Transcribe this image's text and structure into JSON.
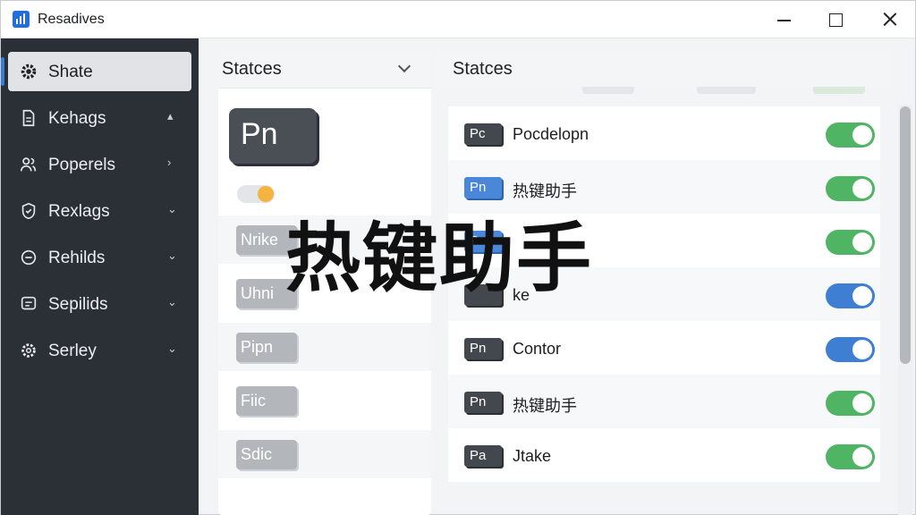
{
  "window": {
    "title": "Resadives"
  },
  "sidebar": {
    "items": [
      {
        "label": "Shate",
        "icon": "gear-icon",
        "active": true
      },
      {
        "label": "Kehags",
        "icon": "document-icon",
        "chevron": "up"
      },
      {
        "label": "Poperels",
        "icon": "users-icon",
        "chevron": "right"
      },
      {
        "label": "Rexlags",
        "icon": "shield-icon",
        "chevron": "down"
      },
      {
        "label": "Rehilds",
        "icon": "circle-minus-icon",
        "chevron": "down"
      },
      {
        "label": "Sepilids",
        "icon": "chat-icon",
        "chevron": "down"
      },
      {
        "label": "Serley",
        "icon": "gear-icon",
        "chevron": "down"
      }
    ]
  },
  "left_panel": {
    "title": "Statces",
    "large_badge": "Pn",
    "chips": [
      "Nrike",
      "Uhni",
      "Pipn",
      "Fiic",
      "Sdic"
    ]
  },
  "right_panel": {
    "title": "Statces",
    "rows": [
      {
        "badge": "Pc",
        "label": "Pocdelopn",
        "toggle": "on",
        "toggle_color": "#4fb463"
      },
      {
        "badge": "Pn",
        "label": "热键助手",
        "toggle": "on",
        "toggle_color": "#4fb463",
        "badge_color": "#4a87d8"
      },
      {
        "badge": "P",
        "label": "",
        "toggle": "on",
        "toggle_color": "#4fb463",
        "badge_color": "#4a87d8"
      },
      {
        "badge": "",
        "label": "ke",
        "toggle": "on",
        "toggle_color": "#3e7fd4"
      },
      {
        "badge": "Pn",
        "label": "Contor",
        "toggle": "on",
        "toggle_color": "#3e7fd4"
      },
      {
        "badge": "Pn",
        "label": "热键助手",
        "toggle": "on",
        "toggle_color": "#4fb463"
      },
      {
        "badge": "Pa",
        "label": "Jtake",
        "toggle": "on",
        "toggle_color": "#4fb463"
      }
    ]
  },
  "overlay_text": "热键助手"
}
